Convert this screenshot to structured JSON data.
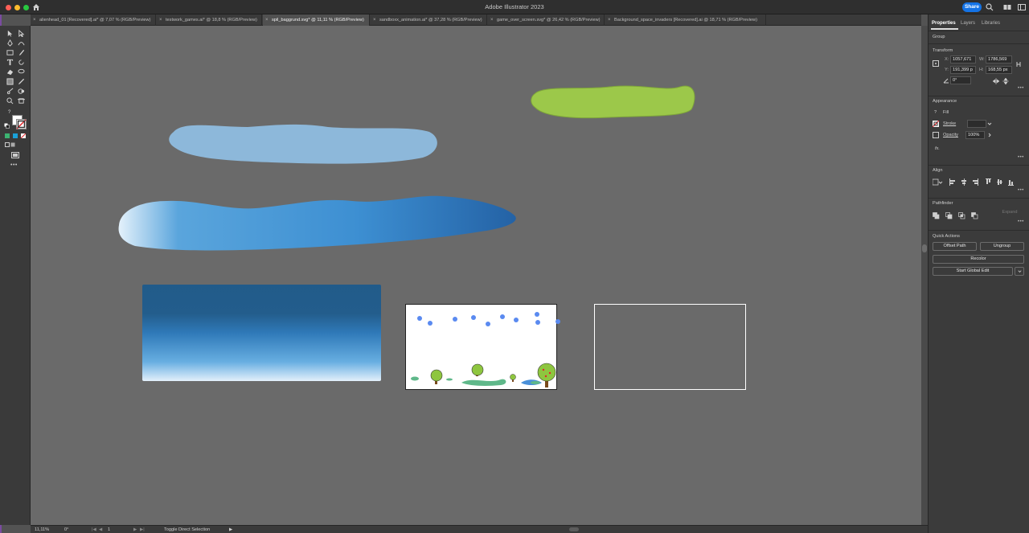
{
  "app": {
    "title": "Adobe Illustrator 2023",
    "share_label": "Share"
  },
  "tabs": [
    {
      "label": "alienhead_01 [Recovered].ai* @ 7,07 % (RGB/Preview)",
      "active": false
    },
    {
      "label": "testwork_games.ai* @ 18,8 % (RGB/Preview)",
      "active": false
    },
    {
      "label": "spil_baggrund.svg* @ 11,11 % (RGB/Preview)",
      "active": true
    },
    {
      "label": "sandboxx_animation.ai* @ 37,28 % (RGB/Preview)",
      "active": false
    },
    {
      "label": "game_over_screen.svg* @ 26,42 % (RGB/Preview)",
      "active": false
    },
    {
      "label": "Background_space_invaders [Recovered].ai @ 18,71 % (RGB/Preview)",
      "active": false
    }
  ],
  "tab_close_glyph": "×",
  "status": {
    "zoom": "11,11%",
    "rotation": "0°",
    "artboard": "1",
    "tool_hint": "Toggle Direct Selection",
    "nav_first": "|◀",
    "nav_prev": "◀",
    "nav_next": "▶",
    "nav_last": "▶|",
    "arrow": "▶"
  },
  "panel": {
    "tabs": {
      "properties": "Properties",
      "layers": "Layers",
      "libraries": "Libraries"
    },
    "selection_type": "Group",
    "transform": {
      "heading": "Transform",
      "x_label": "X:",
      "x_value": "1057,671",
      "y_label": "Y:",
      "y_value": "191,399 p",
      "w_label": "W:",
      "w_value": "1786,569",
      "h_label": "H:",
      "h_value": "168,55 px",
      "angle_value": "0°"
    },
    "appearance": {
      "heading": "Appearance",
      "fill_label": "Fill",
      "stroke_label": "Stroke",
      "opacity_label": "Opacity",
      "opacity_value": "100%",
      "fx_label": "fx."
    },
    "align": {
      "heading": "Align"
    },
    "pathfinder": {
      "heading": "Pathfinder",
      "expand_label": "Expand"
    },
    "quick_actions": {
      "heading": "Quick Actions",
      "offset_path": "Offset Path",
      "ungroup": "Ungroup",
      "recolor": "Recolor",
      "global_edit": "Start Global Edit"
    },
    "more_glyph": "•••",
    "fill_unknown_glyph": "?"
  },
  "colors": {
    "accent": "#1473e6",
    "canvas": "#6a6a6a",
    "cloud_light": "#8db8da",
    "cloud_grass": "#9cc84a",
    "sky_top": "#215b8a",
    "sky_bottom": "#e3f0fb",
    "star_blue": "#5a8af0"
  }
}
